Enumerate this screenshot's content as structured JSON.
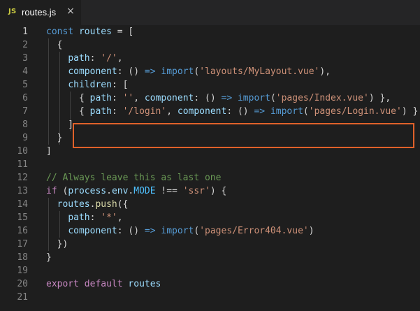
{
  "tab": {
    "icon_label": "JS",
    "file_name": "routes.js",
    "close_glyph": "×"
  },
  "icons": {
    "file_type": "javascript-file-icon",
    "close": "close-icon"
  },
  "colors": {
    "background": "#1e1e1e",
    "highlight_box": "#e0612a"
  },
  "editor": {
    "active_line": 1,
    "lines": [
      {
        "number": "1",
        "tokens": [
          {
            "t": "const",
            "c": "t-keyword"
          },
          {
            "t": " ",
            "c": "t-plain"
          },
          {
            "t": "routes",
            "c": "t-var"
          },
          {
            "t": " = [",
            "c": "t-plain"
          }
        ]
      },
      {
        "number": "2",
        "tokens": [
          {
            "t": "  {",
            "c": "t-plain"
          }
        ]
      },
      {
        "number": "3",
        "tokens": [
          {
            "t": "    ",
            "c": "t-plain"
          },
          {
            "t": "path",
            "c": "t-var"
          },
          {
            "t": ": ",
            "c": "t-plain"
          },
          {
            "t": "'/'",
            "c": "t-string"
          },
          {
            "t": ",",
            "c": "t-plain"
          }
        ]
      },
      {
        "number": "4",
        "tokens": [
          {
            "t": "    ",
            "c": "t-plain"
          },
          {
            "t": "component",
            "c": "t-var"
          },
          {
            "t": ": () ",
            "c": "t-plain"
          },
          {
            "t": "=>",
            "c": "t-keyword"
          },
          {
            "t": " ",
            "c": "t-plain"
          },
          {
            "t": "import",
            "c": "t-keyword"
          },
          {
            "t": "(",
            "c": "t-plain"
          },
          {
            "t": "'layouts/MyLayout.vue'",
            "c": "t-string"
          },
          {
            "t": "),",
            "c": "t-plain"
          }
        ]
      },
      {
        "number": "5",
        "tokens": [
          {
            "t": "    ",
            "c": "t-plain"
          },
          {
            "t": "children",
            "c": "t-var"
          },
          {
            "t": ": [",
            "c": "t-plain"
          }
        ]
      },
      {
        "number": "6",
        "tokens": [
          {
            "t": "      { ",
            "c": "t-plain"
          },
          {
            "t": "path",
            "c": "t-var"
          },
          {
            "t": ": ",
            "c": "t-plain"
          },
          {
            "t": "''",
            "c": "t-string"
          },
          {
            "t": ", ",
            "c": "t-plain"
          },
          {
            "t": "component",
            "c": "t-var"
          },
          {
            "t": ": () ",
            "c": "t-plain"
          },
          {
            "t": "=>",
            "c": "t-keyword"
          },
          {
            "t": " ",
            "c": "t-plain"
          },
          {
            "t": "import",
            "c": "t-keyword"
          },
          {
            "t": "(",
            "c": "t-plain"
          },
          {
            "t": "'pages/Index.vue'",
            "c": "t-string"
          },
          {
            "t": ") },",
            "c": "t-plain"
          }
        ]
      },
      {
        "number": "7",
        "tokens": [
          {
            "t": "      { ",
            "c": "t-plain"
          },
          {
            "t": "path",
            "c": "t-var"
          },
          {
            "t": ": ",
            "c": "t-plain"
          },
          {
            "t": "'/login'",
            "c": "t-string"
          },
          {
            "t": ", ",
            "c": "t-plain"
          },
          {
            "t": "component",
            "c": "t-var"
          },
          {
            "t": ": () ",
            "c": "t-plain"
          },
          {
            "t": "=>",
            "c": "t-keyword"
          },
          {
            "t": " ",
            "c": "t-plain"
          },
          {
            "t": "import",
            "c": "t-keyword"
          },
          {
            "t": "(",
            "c": "t-plain"
          },
          {
            "t": "'pages/Login.vue'",
            "c": "t-string"
          },
          {
            "t": ") }",
            "c": "t-plain"
          }
        ]
      },
      {
        "number": "8",
        "tokens": [
          {
            "t": "    ]",
            "c": "t-plain"
          }
        ]
      },
      {
        "number": "9",
        "tokens": [
          {
            "t": "  }",
            "c": "t-plain"
          }
        ]
      },
      {
        "number": "10",
        "tokens": [
          {
            "t": "]",
            "c": "t-plain"
          }
        ]
      },
      {
        "number": "11",
        "tokens": []
      },
      {
        "number": "12",
        "tokens": [
          {
            "t": "// Always leave this as last one",
            "c": "t-comment"
          }
        ]
      },
      {
        "number": "13",
        "tokens": [
          {
            "t": "if",
            "c": "t-control"
          },
          {
            "t": " (",
            "c": "t-plain"
          },
          {
            "t": "process",
            "c": "t-var"
          },
          {
            "t": ".",
            "c": "t-plain"
          },
          {
            "t": "env",
            "c": "t-var"
          },
          {
            "t": ".",
            "c": "t-plain"
          },
          {
            "t": "MODE",
            "c": "t-const"
          },
          {
            "t": " !== ",
            "c": "t-plain"
          },
          {
            "t": "'ssr'",
            "c": "t-string"
          },
          {
            "t": ") {",
            "c": "t-plain"
          }
        ]
      },
      {
        "number": "14",
        "tokens": [
          {
            "t": "  ",
            "c": "t-plain"
          },
          {
            "t": "routes",
            "c": "t-var"
          },
          {
            "t": ".",
            "c": "t-plain"
          },
          {
            "t": "push",
            "c": "t-func"
          },
          {
            "t": "({",
            "c": "t-plain"
          }
        ]
      },
      {
        "number": "15",
        "tokens": [
          {
            "t": "    ",
            "c": "t-plain"
          },
          {
            "t": "path",
            "c": "t-var"
          },
          {
            "t": ": ",
            "c": "t-plain"
          },
          {
            "t": "'*'",
            "c": "t-string"
          },
          {
            "t": ",",
            "c": "t-plain"
          }
        ]
      },
      {
        "number": "16",
        "tokens": [
          {
            "t": "    ",
            "c": "t-plain"
          },
          {
            "t": "component",
            "c": "t-var"
          },
          {
            "t": ": () ",
            "c": "t-plain"
          },
          {
            "t": "=>",
            "c": "t-keyword"
          },
          {
            "t": " ",
            "c": "t-plain"
          },
          {
            "t": "import",
            "c": "t-keyword"
          },
          {
            "t": "(",
            "c": "t-plain"
          },
          {
            "t": "'pages/Error404.vue'",
            "c": "t-string"
          },
          {
            "t": ")",
            "c": "t-plain"
          }
        ]
      },
      {
        "number": "17",
        "tokens": [
          {
            "t": "  })",
            "c": "t-plain"
          }
        ]
      },
      {
        "number": "18",
        "tokens": [
          {
            "t": "}",
            "c": "t-plain"
          }
        ]
      },
      {
        "number": "19",
        "tokens": []
      },
      {
        "number": "20",
        "tokens": [
          {
            "t": "export",
            "c": "t-control"
          },
          {
            "t": " ",
            "c": "t-plain"
          },
          {
            "t": "default",
            "c": "t-control"
          },
          {
            "t": " ",
            "c": "t-plain"
          },
          {
            "t": "routes",
            "c": "t-var"
          }
        ]
      },
      {
        "number": "21",
        "tokens": []
      }
    ]
  }
}
